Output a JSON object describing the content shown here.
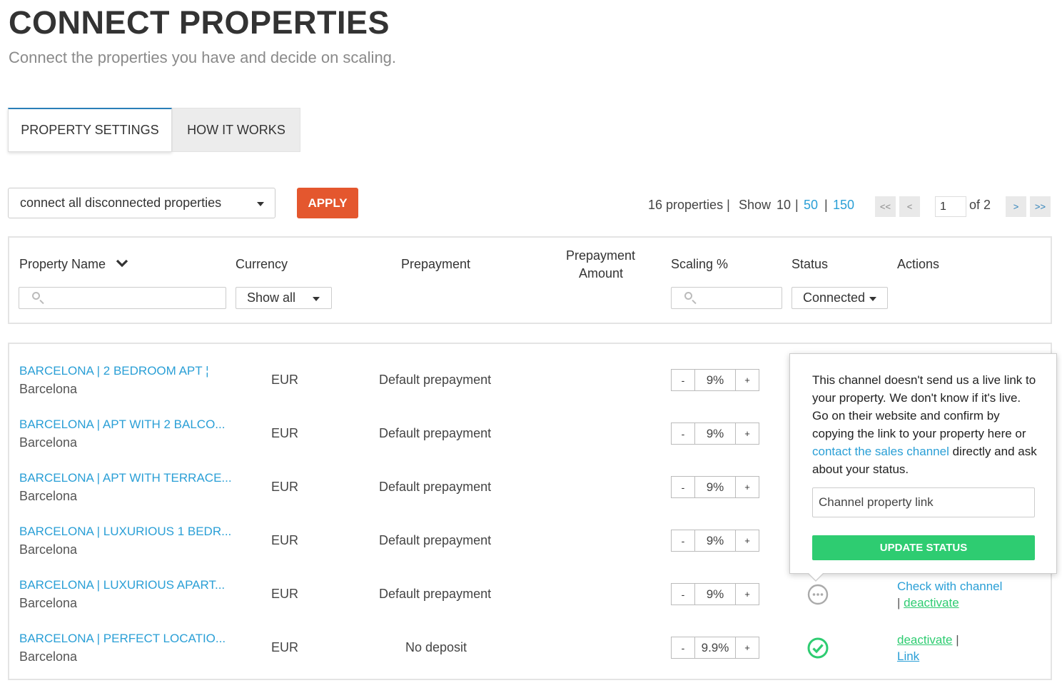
{
  "page": {
    "title": "CONNECT PROPERTIES",
    "subtitle": "Connect the properties you have and decide on scaling."
  },
  "tabs": [
    {
      "label": "PROPERTY SETTINGS",
      "active": true
    },
    {
      "label": "HOW IT WORKS",
      "active": false
    }
  ],
  "bulk": {
    "selected": "connect all disconnected properties",
    "apply_label": "APPLY"
  },
  "pager": {
    "count_text": "16 properties |",
    "show_label": "Show",
    "show_options": [
      "10",
      "50",
      "150"
    ],
    "sep": "|",
    "first": "<<",
    "prev": "<",
    "current_page": "1",
    "of_text": "of 2",
    "next": ">",
    "last": ">>"
  },
  "columns": {
    "property_name": "Property Name",
    "currency": "Currency",
    "prepayment": "Prepayment",
    "prepayment_amount_1": "Prepayment",
    "prepayment_amount_2": "Amount",
    "scaling": "Scaling %",
    "status": "Status",
    "actions": "Actions"
  },
  "filters": {
    "currency": "Show all",
    "status": "Connected"
  },
  "rows": [
    {
      "name": "BARCELONA | 2 BEDROOM APT ¦",
      "city": "Barcelona",
      "currency": "EUR",
      "prepayment": "Default prepayment",
      "scaling": "9%"
    },
    {
      "name": "BARCELONA | APT WITH 2 BALCO...",
      "city": "Barcelona",
      "currency": "EUR",
      "prepayment": "Default prepayment",
      "scaling": "9%"
    },
    {
      "name": "BARCELONA | APT WITH TERRACE...",
      "city": "Barcelona",
      "currency": "EUR",
      "prepayment": "Default prepayment",
      "scaling": "9%"
    },
    {
      "name": "BARCELONA | LUXURIOUS 1 BEDR...",
      "city": "Barcelona",
      "currency": "EUR",
      "prepayment": "Default prepayment",
      "scaling": "9%"
    },
    {
      "name": "BARCELONA | LUXURIOUS APART...",
      "city": "Barcelona",
      "currency": "EUR",
      "prepayment": "Default prepayment",
      "scaling": "9%"
    },
    {
      "name": "BARCELONA | PERFECT LOCATIO...",
      "city": "Barcelona",
      "currency": "EUR",
      "prepayment": "No deposit",
      "scaling": "9.9%"
    }
  ],
  "scale_controls": {
    "minus": "-",
    "plus": "+"
  },
  "row5_actions": {
    "check": "Check with channel",
    "sep": "|",
    "deactivate": "deactivate"
  },
  "row6_actions": {
    "deactivate": "deactivate",
    "sep": "|",
    "link": "Link"
  },
  "popover": {
    "text_1": "This channel doesn't send us a live link to your property. We don't know if it's live. Go on their website and confirm by copying the link to your property here or",
    "link_text": "contact the sales channel",
    "text_2": "directly and ask about your status.",
    "input_placeholder": "Channel property link",
    "button": "UPDATE STATUS"
  },
  "colors": {
    "accent": "#2a9fd6",
    "apply": "#e4572e",
    "success": "#2ecc71"
  }
}
